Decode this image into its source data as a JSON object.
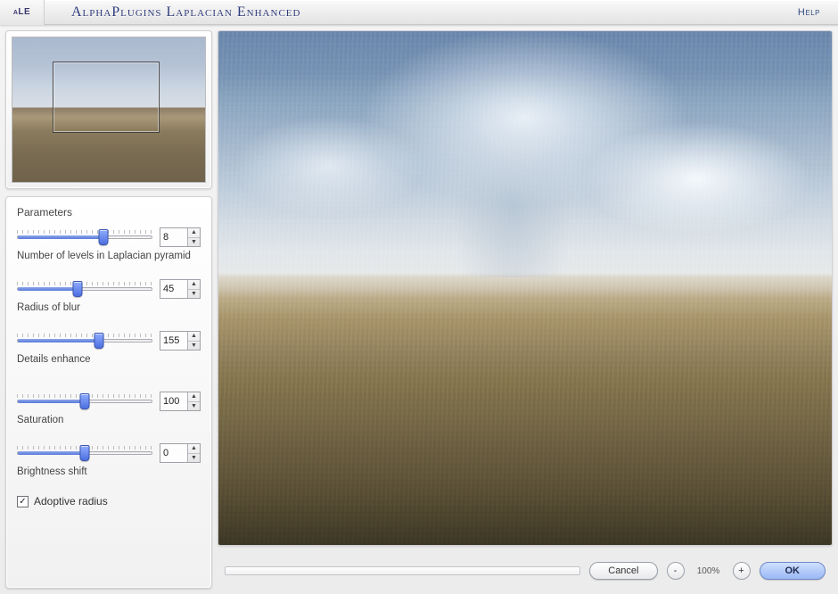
{
  "header": {
    "logo": "aLE",
    "title": "AlphaPlugins Laplacian Enhanced",
    "help": "Help"
  },
  "panel": {
    "title": "Parameters",
    "sliders": {
      "levels": {
        "label": "Number of levels in Laplacian pyramid",
        "value": 8,
        "min": 1,
        "max": 12
      },
      "radius": {
        "label": "Radius of blur",
        "value": 45,
        "min": 0,
        "max": 100
      },
      "details": {
        "label": "Details enhance",
        "value": 155,
        "min": 0,
        "max": 255
      },
      "saturation": {
        "label": "Saturation",
        "value": 100,
        "min": 0,
        "max": 200
      },
      "brightness": {
        "label": "Brightness shift",
        "value": 0,
        "min": -100,
        "max": 100
      }
    },
    "checkbox": {
      "label": "Adoptive radius",
      "checked": true
    }
  },
  "toolbar": {
    "cancel": "Cancel",
    "ok": "OK",
    "zoom_out": "-",
    "zoom_in": "+",
    "zoom_label": "100%"
  }
}
